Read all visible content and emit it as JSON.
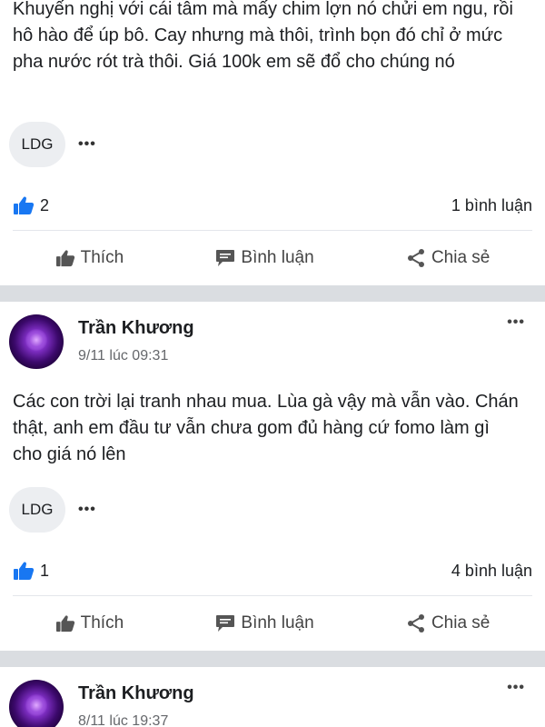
{
  "post1": {
    "text": "Khuyến nghị với cái tâm mà mấy chim lợn nó chửi em ngu, rồi hô hào để úp bô. Cay nhưng mà thôi, trình bọn đó chỉ ở mức pha nước rót trà thôi. Giá 100k em sẽ đổ cho chúng nó",
    "tag": "LDG",
    "likes": "2",
    "comments": "1 bình luận"
  },
  "post2": {
    "author": "Trần Khương",
    "time": "9/11 lúc 09:31",
    "text": "Các con trời lại tranh nhau mua. Lùa gà vậy mà vẫn vào. Chán thật, anh em đầu tư vẫn chưa gom đủ hàng cứ fomo làm gì cho giá nó lên",
    "tag": "LDG",
    "likes": "1",
    "comments": "4 bình luận"
  },
  "post3": {
    "author": "Trần Khương",
    "time": "8/11 lúc 19:37"
  },
  "actions": {
    "like": "Thích",
    "comment": "Bình luận",
    "share": "Chia sẻ"
  },
  "menu_glyph": "•••",
  "colors": {
    "like_blue": "#1877f2",
    "divider": "#dadde1",
    "icon_gray": "#555555"
  },
  "icons": [
    "thumbs-up-icon",
    "comment-icon",
    "share-icon",
    "more-options-icon"
  ]
}
